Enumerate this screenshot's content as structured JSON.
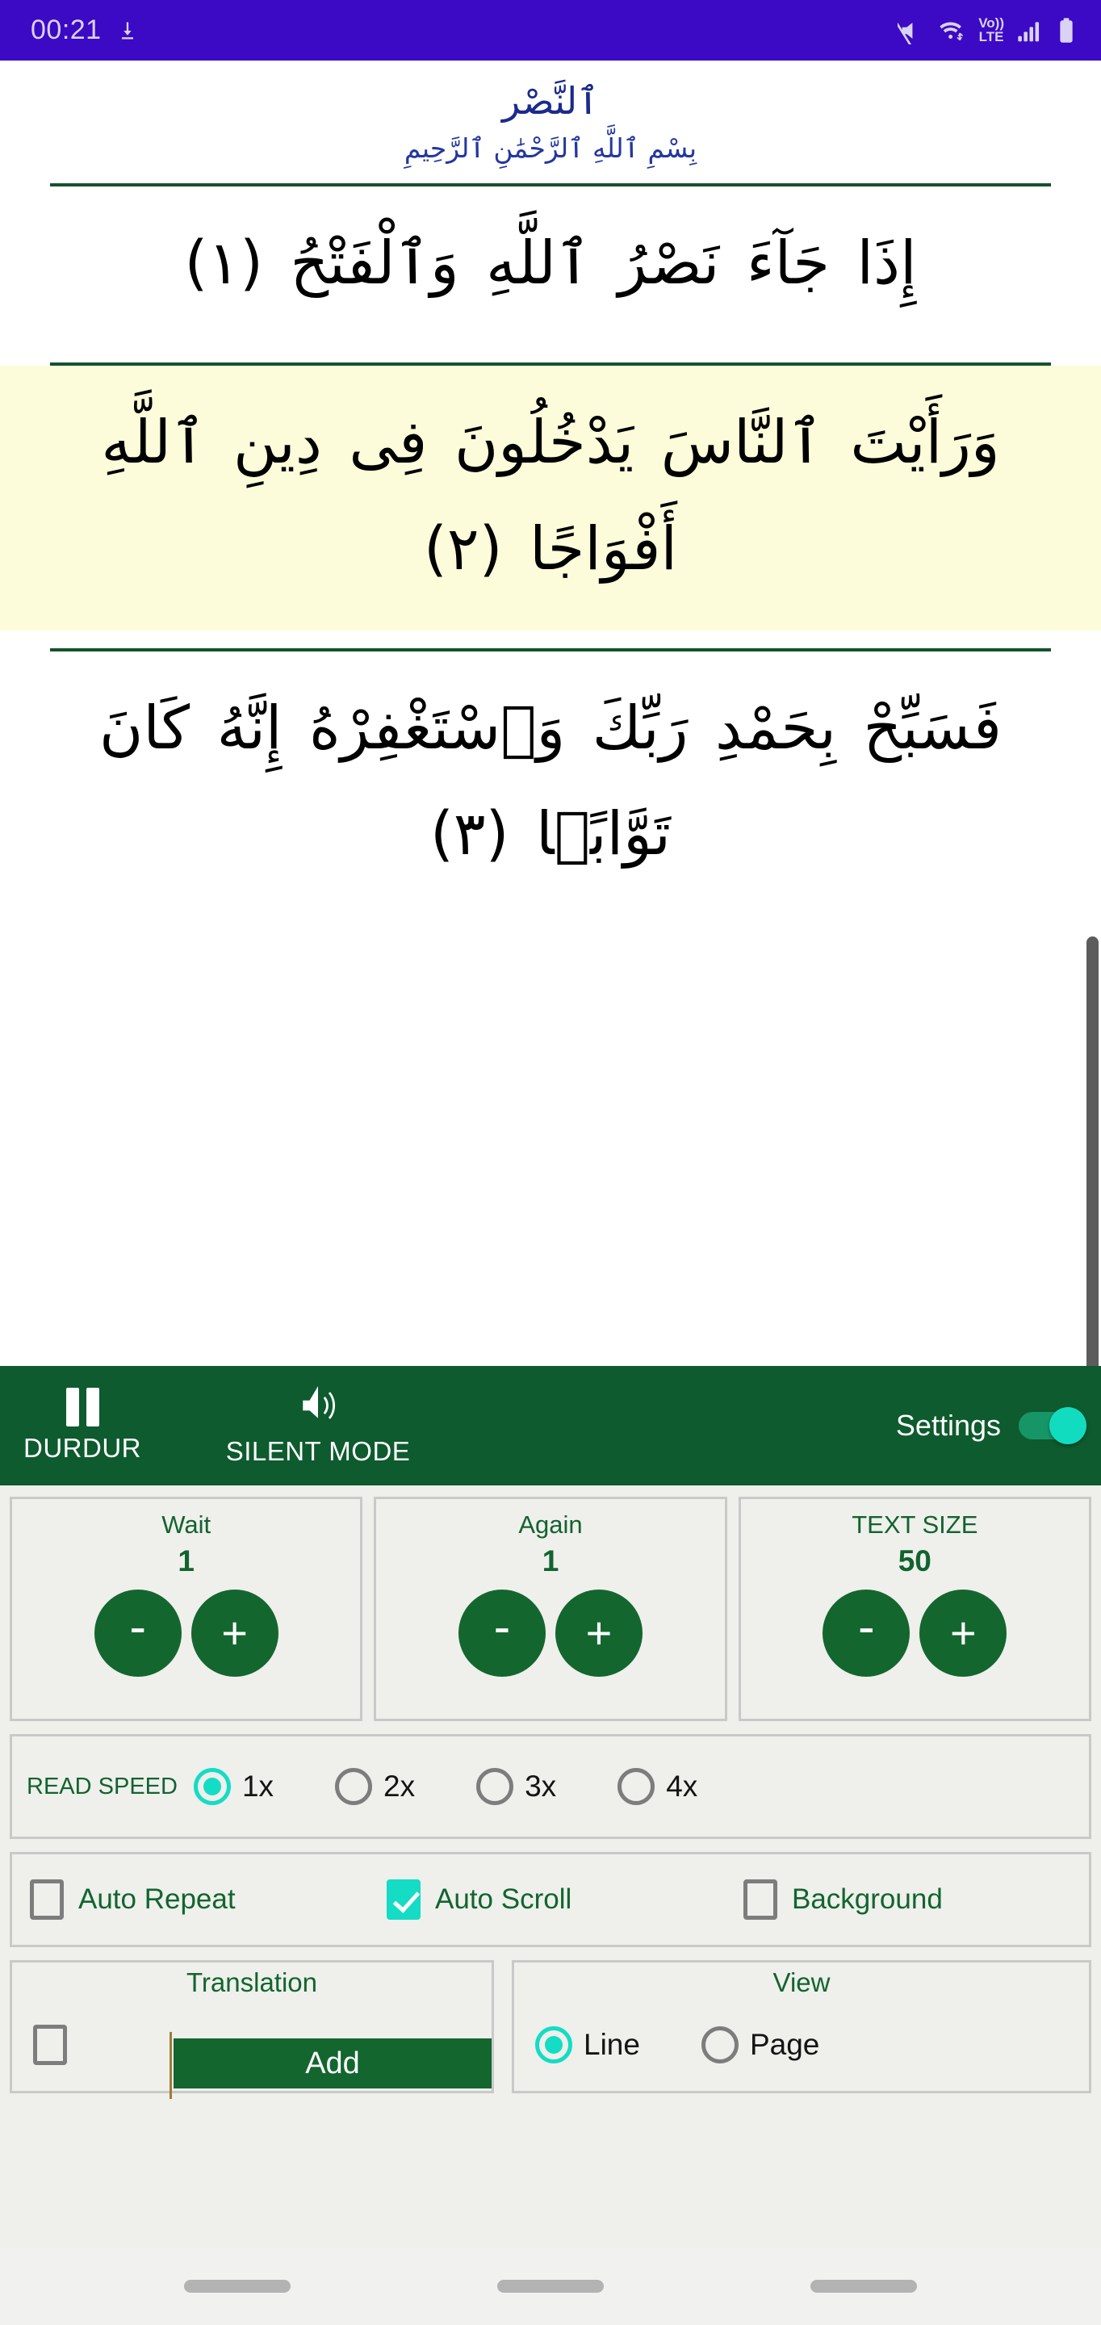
{
  "statusbar": {
    "time": "00:21",
    "icons": [
      "download-icon",
      "mute-icon",
      "wifi-icon",
      "volte-icon",
      "signal-icon",
      "battery-icon"
    ],
    "volte_top": "Vo))",
    "volte_bottom": "LTE",
    "background_color": "#3c09c4"
  },
  "reader": {
    "surah_title": "ٱلنَّصْر",
    "basmala": "بِسْمِ ٱللَّهِ ٱلرَّحْمَٰنِ ٱلرَّحِيمِ",
    "title_color": "#1b2a8c",
    "divider_color": "#14532d",
    "highlight_color": "#fcfcda",
    "ayahs": [
      {
        "number": "١",
        "text": "إِذَا جَآءَ نَصْرُ ٱللَّهِ وَٱلْفَتْحُ (١)",
        "highlighted": false
      },
      {
        "number": "٢",
        "text": "وَرَأَيْتَ ٱلنَّاسَ يَدْخُلُونَ فِى دِينِ ٱللَّهِ أَفْوَاجًا (٢)",
        "highlighted": true
      },
      {
        "number": "٣",
        "text": "فَسَبِّحْ بِحَمْدِ رَبِّكَ وَٱسْتَغْفِرْهُ إِنَّهُ كَانَ تَوَّابًۢا (٣)",
        "highlighted": false
      }
    ]
  },
  "greenbar": {
    "background_color": "#0d5b2e",
    "pause_label": "DURDUR",
    "silent_label": "SILENT MODE",
    "settings_label": "Settings",
    "settings_toggle_on": true,
    "toggle_color": "#12dcc0"
  },
  "steppers": [
    {
      "title": "Wait",
      "value": "1",
      "minus": "-",
      "plus": "+"
    },
    {
      "title": "Again",
      "value": "1",
      "minus": "-",
      "plus": "+"
    },
    {
      "title": "TEXT SIZE",
      "value": "50",
      "minus": "-",
      "plus": "+"
    }
  ],
  "read_speed": {
    "label": "READ SPEED",
    "selected": "1x",
    "options": [
      {
        "label": "1x",
        "selected": true
      },
      {
        "label": "2x",
        "selected": false
      },
      {
        "label": "3x",
        "selected": false
      },
      {
        "label": "4x",
        "selected": false
      }
    ],
    "accent_color": "#14dcc5"
  },
  "checkboxes": [
    {
      "label": "Auto Repeat",
      "checked": false
    },
    {
      "label": "Auto Scroll",
      "checked": true
    },
    {
      "label": "Background",
      "checked": false
    }
  ],
  "translation": {
    "title": "Translation",
    "checked": false,
    "add_label": "Add",
    "button_color": "#14662f"
  },
  "view": {
    "title": "View",
    "options": [
      {
        "label": "Line",
        "selected": true
      },
      {
        "label": "Page",
        "selected": false
      }
    ]
  },
  "navbar": {
    "pills": 3
  }
}
